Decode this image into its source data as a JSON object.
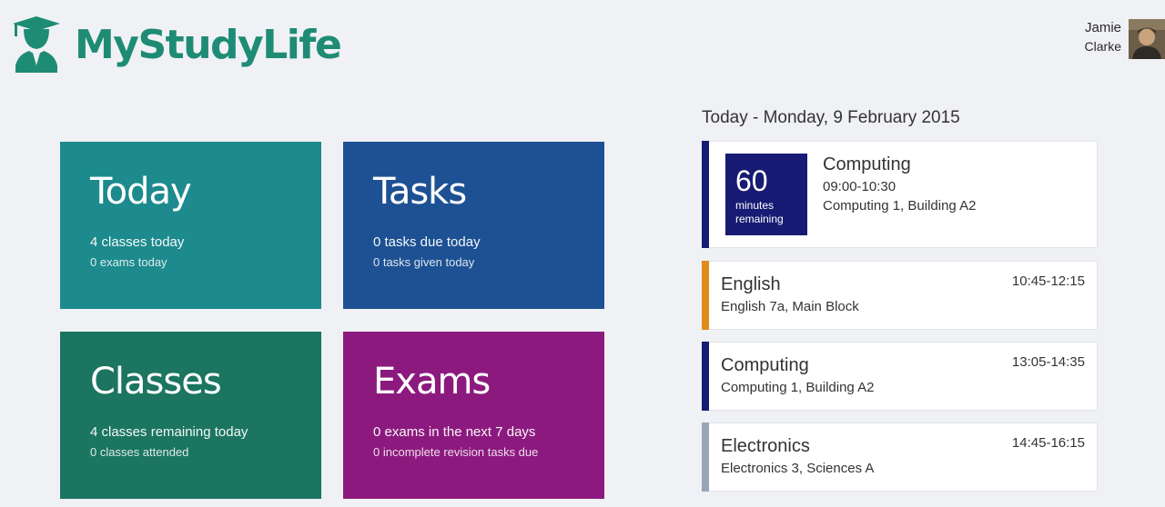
{
  "app": {
    "name": "MyStudyLife"
  },
  "user": {
    "first_name": "Jamie",
    "last_name": "Clarke"
  },
  "tiles": {
    "today": {
      "title": "Today",
      "line1": "4 classes today",
      "line2": "0 exams today",
      "color": "#1d8a8d"
    },
    "tasks": {
      "title": "Tasks",
      "line1": "0 tasks due today",
      "line2": "0 tasks given today",
      "color": "#1d5193"
    },
    "classes": {
      "title": "Classes",
      "line1": "4 classes remaining today",
      "line2": "0 classes attended",
      "color": "#1b7560"
    },
    "exams": {
      "title": "Exams",
      "line1": "0 exams in the next 7 days",
      "line2": "0 incomplete revision tasks due",
      "color": "#8c1a7e"
    }
  },
  "schedule": {
    "heading": "Today - Monday, 9 February 2015",
    "current": {
      "countdown_value": "60",
      "countdown_unit_1": "minutes",
      "countdown_unit_2": "remaining",
      "title": "Computing",
      "time": "09:00-10:30",
      "location": "Computing 1, Building A2",
      "color": "#171b73"
    },
    "items": [
      {
        "title": "English",
        "location": "English 7a, Main Block",
        "time": "10:45-12:15",
        "color": "#e08a1c"
      },
      {
        "title": "Computing",
        "location": "Computing 1, Building A2",
        "time": "13:05-14:35",
        "color": "#171b73"
      },
      {
        "title": "Electronics",
        "location": "Electronics 3, Sciences A",
        "time": "14:45-16:15",
        "color": "#98a4b8"
      }
    ]
  },
  "colors": {
    "brand": "#1e8c74",
    "background": "#f0f1f5"
  },
  "icons": {
    "logo": "graduate-logo-icon",
    "avatar": "user-avatar"
  }
}
